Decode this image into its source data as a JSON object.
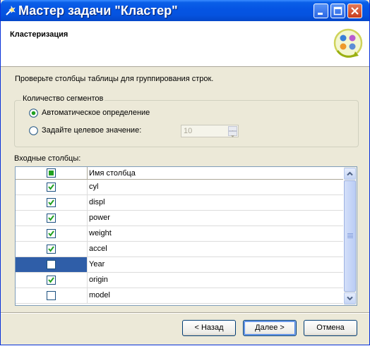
{
  "window": {
    "title": "Мастер задачи \"Кластер\"",
    "icons": {
      "app": "wand-icon",
      "minimize": "minimize-icon",
      "maximize": "maximize-icon",
      "close": "close-icon"
    }
  },
  "header": {
    "title": "Кластеризация",
    "icon": "clustering-wizard-icon"
  },
  "instruction": "Проверьте столбцы таблицы для группирования строк.",
  "segments": {
    "group_label": "Количество сегментов",
    "auto_label": "Автоматическое определение",
    "auto_selected": true,
    "target_label": "Задайте целевое значение:",
    "target_selected": false,
    "target_value": "10"
  },
  "columns": {
    "label": "Входные столбцы:",
    "header": "Имя столбца",
    "rows": [
      {
        "name": "cyl",
        "checked": true,
        "selected": false
      },
      {
        "name": "displ",
        "checked": true,
        "selected": false
      },
      {
        "name": "power",
        "checked": true,
        "selected": false
      },
      {
        "name": "weight",
        "checked": true,
        "selected": false
      },
      {
        "name": "accel",
        "checked": true,
        "selected": false
      },
      {
        "name": "Year",
        "checked": false,
        "selected": true
      },
      {
        "name": "origin",
        "checked": true,
        "selected": false
      },
      {
        "name": "model",
        "checked": false,
        "selected": false
      }
    ]
  },
  "buttons": {
    "back": "< Назад",
    "next": "Далее >",
    "cancel": "Отмена"
  },
  "colors": {
    "titlebar": "#0554e3",
    "selection": "#2f5ea8",
    "check": "#21a121"
  }
}
